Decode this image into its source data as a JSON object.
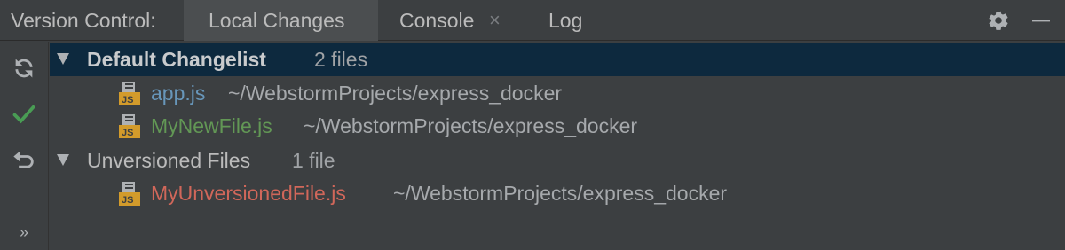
{
  "header": {
    "title": "Version Control:",
    "tabs": [
      {
        "label": "Local Changes",
        "active": true
      },
      {
        "label": "Console",
        "closable": true,
        "close_glyph": "×"
      },
      {
        "label": "Log"
      }
    ],
    "icons": [
      "gear-icon",
      "minimize-icon"
    ]
  },
  "toolbar": {
    "buttons": [
      {
        "icon": "refresh-icon"
      },
      {
        "icon": "checkmark-icon"
      },
      {
        "icon": "rollback-icon"
      },
      {
        "icon": "more-icon",
        "glyph": "»"
      }
    ]
  },
  "tree": {
    "groups": [
      {
        "label": "Default Changelist",
        "count": "2 files",
        "selected": true,
        "files": [
          {
            "name": "app.js",
            "path": "~/WebstormProjects/express_docker",
            "status": "modified",
            "color": "#6897bb"
          },
          {
            "name": "MyNewFile.js",
            "path": "~/WebstormProjects/express_docker",
            "status": "added",
            "color": "#629755"
          }
        ]
      },
      {
        "label": "Unversioned Files",
        "count": "1 file",
        "selected": false,
        "files": [
          {
            "name": "MyUnversionedFile.js",
            "path": "~/WebstormProjects/express_docker",
            "status": "unversioned",
            "color": "#d1675a"
          }
        ]
      }
    ]
  },
  "colors": {
    "background": "#3c3f41",
    "selection": "#0d293e",
    "active_tab": "#4b4e50",
    "commit_green": "#499c54",
    "js_icon": "#d39b2b"
  }
}
